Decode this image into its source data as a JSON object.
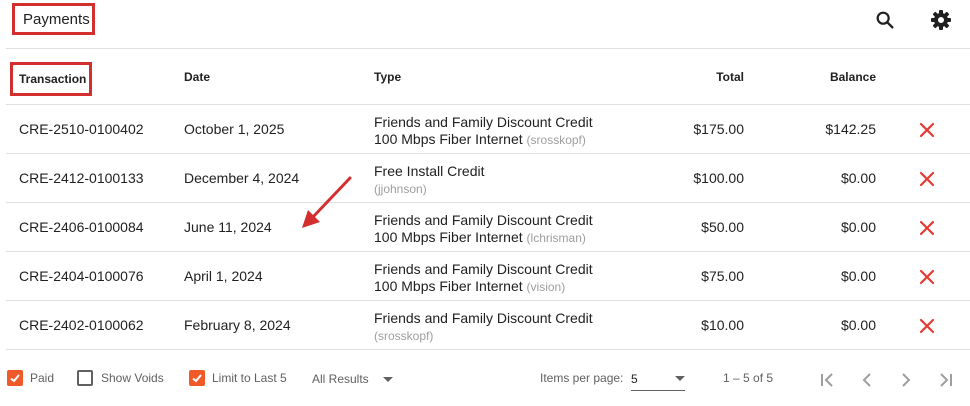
{
  "header": {
    "title": "Payments",
    "search_icon": "search-icon",
    "settings_icon": "gear-icon"
  },
  "table": {
    "columns": {
      "transaction": "Transaction",
      "date": "Date",
      "type": "Type",
      "total": "Total",
      "balance": "Balance"
    },
    "rows": [
      {
        "transaction": "CRE-2510-0100402",
        "date": "October 1, 2025",
        "type_line1": "Friends and Family Discount Credit",
        "type_line2": "100 Mbps Fiber Internet",
        "user": "(srosskopf)",
        "total": "$175.00",
        "balance": "$142.25"
      },
      {
        "transaction": "CRE-2412-0100133",
        "date": "December 4, 2024",
        "type_line1": "Free Install Credit",
        "type_line2": "",
        "user": "(jjohnson)",
        "total": "$100.00",
        "balance": "$0.00"
      },
      {
        "transaction": "CRE-2406-0100084",
        "date": "June 11, 2024",
        "type_line1": "Friends and Family Discount Credit",
        "type_line2": "100 Mbps Fiber Internet",
        "user": "(lchrisman)",
        "total": "$50.00",
        "balance": "$0.00"
      },
      {
        "transaction": "CRE-2404-0100076",
        "date": "April 1, 2024",
        "type_line1": "Friends and Family Discount Credit",
        "type_line2": "100 Mbps Fiber Internet",
        "user": "(vision)",
        "total": "$75.00",
        "balance": "$0.00"
      },
      {
        "transaction": "CRE-2402-0100062",
        "date": "February 8, 2024",
        "type_line1": "Friends and Family Discount Credit",
        "type_line2": "",
        "user": "(srosskopf)",
        "total": "$10.00",
        "balance": "$0.00"
      }
    ],
    "delete_icon": "close-icon"
  },
  "footer": {
    "paid": {
      "label": "Paid",
      "checked": true
    },
    "show_voids": {
      "label": "Show Voids",
      "checked": false
    },
    "limit": {
      "label": "Limit to Last 5",
      "checked": true
    },
    "results_filter": "All Results",
    "items_per_page_label": "Items per page:",
    "items_per_page": "5",
    "range": "1 – 5 of 5"
  },
  "colors": {
    "annotation_red": "#d32f2f",
    "delete_red": "#e53935",
    "checkbox_orange": "#f05a28"
  }
}
